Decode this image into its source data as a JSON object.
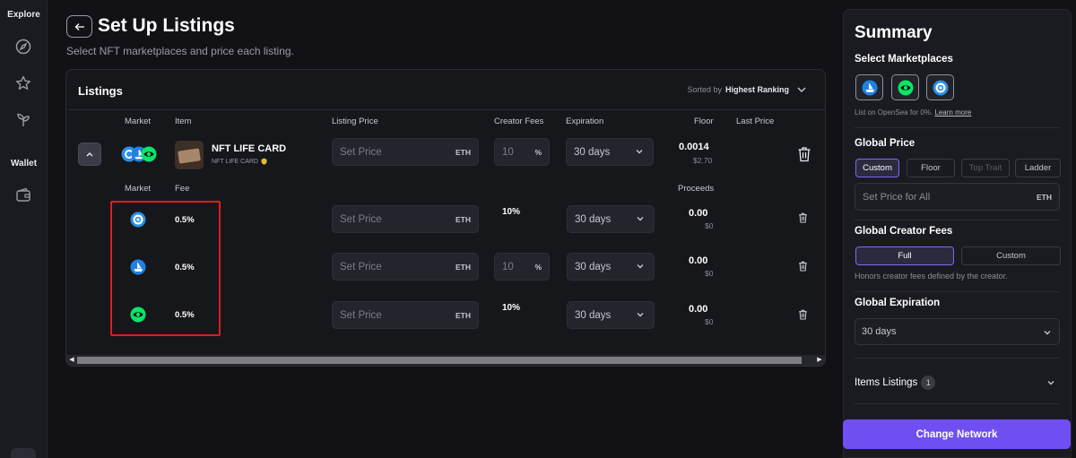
{
  "rail": {
    "explore_label": "Explore",
    "wallet_label": "Wallet"
  },
  "header": {
    "title": "Set Up Listings",
    "subtitle": "Select NFT marketplaces and price each listing."
  },
  "listings": {
    "title": "Listings",
    "sort_prefix": "Sorted by",
    "sort_value": "Highest Ranking",
    "columns": {
      "market": "Market",
      "item": "Item",
      "listing_price": "Listing Price",
      "creator_fees": "Creator Fees",
      "expiration": "Expiration",
      "floor": "Floor",
      "last_price": "Last Price"
    },
    "item": {
      "name": "NFT LIFE CARD",
      "collection": "NFT LIFE CARD",
      "price_placeholder": "Set Price",
      "price_unit": "ETH",
      "creator_fee": "10",
      "creator_fee_unit": "%",
      "expiration": "30 days",
      "floor": "0.0014",
      "floor_usd": "$2.70"
    },
    "sub_columns": {
      "market": "Market",
      "fee": "Fee",
      "proceeds": "Proceeds"
    },
    "markets": [
      {
        "icon": "opensea-pro-icon",
        "fee": "0.5%",
        "price_placeholder": "Set Price",
        "price_unit": "ETH",
        "creator_fee": "10%",
        "creator_fee_editable": false,
        "expiration": "30 days",
        "proceeds": "0.00",
        "proceeds_usd": "$0"
      },
      {
        "icon": "opensea-icon",
        "fee": "0.5%",
        "price_placeholder": "Set Price",
        "price_unit": "ETH",
        "creator_fee": "10",
        "creator_fee_unit": "%",
        "creator_fee_editable": true,
        "expiration": "30 days",
        "proceeds": "0.00",
        "proceeds_usd": "$0"
      },
      {
        "icon": "looksrare-icon",
        "fee": "0.5%",
        "price_placeholder": "Set Price",
        "price_unit": "ETH",
        "creator_fee": "10%",
        "creator_fee_editable": false,
        "expiration": "30 days",
        "proceeds": "0.00",
        "proceeds_usd": "$0"
      }
    ]
  },
  "summary": {
    "title": "Summary",
    "select_marketplaces": "Select Marketplaces",
    "opensea_hint": "List on OpenSea for 0%.",
    "learn_more": "Learn more",
    "global_price": "Global Price",
    "price_modes": [
      "Custom",
      "Floor",
      "Top Trait",
      "Ladder"
    ],
    "set_price_all": "Set Price for All",
    "price_unit": "ETH",
    "global_creator_fees": "Global Creator Fees",
    "fee_modes": [
      "Full",
      "Custom"
    ],
    "fee_hint": "Honors creator fees defined by the creator.",
    "global_expiration": "Global Expiration",
    "expiration_value": "30 days",
    "items_listings": "Items Listings",
    "items_count": "1",
    "change_network": "Change Network"
  },
  "colors": {
    "accent": "#6f4ff2",
    "highlight_box": "#e11d1d",
    "opensea_blue": "#2081e2",
    "looksrare_green": "#0ce466"
  }
}
